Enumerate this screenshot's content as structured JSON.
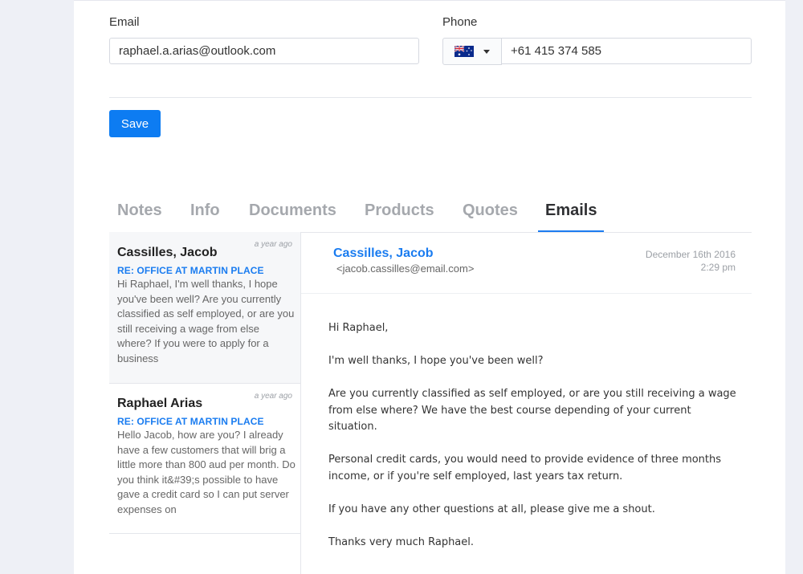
{
  "form": {
    "email_label": "Email",
    "email_value": "raphael.a.arias@outlook.com",
    "phone_label": "Phone",
    "phone_value": "+61 415 374 585",
    "country_flag": "australia-flag",
    "save_label": "Save"
  },
  "tabs": [
    {
      "label": "Notes",
      "active": false
    },
    {
      "label": "Info",
      "active": false
    },
    {
      "label": "Documents",
      "active": false
    },
    {
      "label": "Products",
      "active": false
    },
    {
      "label": "Quotes",
      "active": false
    },
    {
      "label": "Emails",
      "active": true
    }
  ],
  "emails": [
    {
      "name": "Cassilles, Jacob",
      "time": "a year ago",
      "subject": "RE: OFFICE AT MARTIN PLACE",
      "preview": "Hi Raphael, I'm well thanks, I hope you've been well? Are you currently classified as self employed, or are you still receiving a wage from else where? If you were to apply for a business"
    },
    {
      "name": "Raphael Arias",
      "time": "a year ago",
      "subject": "RE: OFFICE AT MARTIN PLACE",
      "preview": "Hello Jacob, how are you? I already have a few customers that will brig a little more than 800 aud per month. Do you think it&#39;s possible to have gave a credit card so I can put server expenses on"
    }
  ],
  "detail": {
    "from_name": "Cassilles, Jacob",
    "from_email": "<jacob.cassilles@email.com>",
    "date": "December 16th 2016",
    "time": "2:29 pm",
    "paragraphs": [
      "Hi Raphael,",
      "I'm well thanks, I hope you've been well?",
      "Are you currently classified as self employed, or are you still receiving a wage from else where? We have the best course depending of your current situation.",
      "Personal credit cards, you would need to provide evidence of three months income, or if you're self employed, last years tax return.",
      "If you have any other questions at all, please give me a shout.",
      "Thanks very much Raphael."
    ]
  },
  "colors": {
    "accent": "#1a7cf0",
    "button": "#0d7cf2",
    "background": "#eef0f6"
  }
}
